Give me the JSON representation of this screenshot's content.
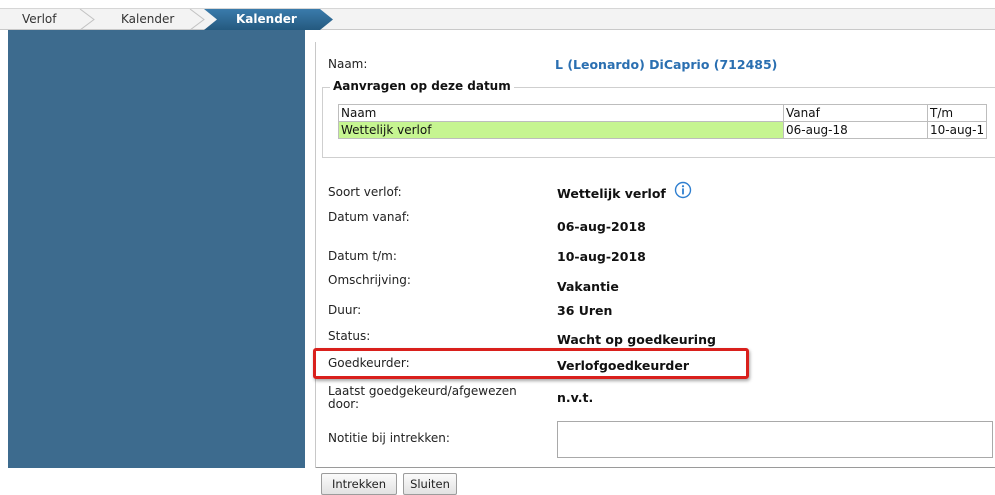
{
  "breadcrumb": {
    "items": [
      "Verlof",
      "Kalender",
      "Kalender"
    ],
    "active_index": 2
  },
  "naam": {
    "label": "Naam:",
    "value": "L (Leonardo) DiCaprio (712485)"
  },
  "aanvragen": {
    "legend": "Aanvragen op deze datum",
    "headers": [
      "Naam",
      "Vanaf",
      "T/m"
    ],
    "rows": [
      [
        "Wettelijk verlof",
        "06-aug-18",
        "10-aug-1"
      ]
    ]
  },
  "details": [
    {
      "label": "Soort verlof:",
      "value": "Wettelijk verlof"
    },
    {
      "label": "Datum vanaf:",
      "value": "06-aug-2018"
    },
    {
      "label": "Datum t/m:",
      "value": "10-aug-2018"
    },
    {
      "label": "Omschrijving:",
      "value": "Vakantie"
    },
    {
      "label": "Duur:",
      "value": "36 Uren"
    },
    {
      "label": "Status:",
      "value": "Wacht op goedkeuring"
    },
    {
      "label": "Goedkeurder:",
      "value": "Verlofgoedkeurder"
    },
    {
      "label": "Laatst goedgekeurd/afgewezen door:",
      "value": "n.v.t."
    }
  ],
  "notitie": {
    "label": "Notitie bij intrekken:",
    "value": ""
  },
  "buttons": {
    "intrekken": "Intrekken",
    "sluiten": "Sluiten"
  },
  "icons": {
    "soort_verlof_info": "info-icon"
  },
  "colors": {
    "sidebar": "#3d6b8e",
    "active_crumb": "#2e6a95",
    "naam_value": "#2a6fb1",
    "row_highlight": "#c6f591",
    "annotation_box": "#d9201c"
  }
}
